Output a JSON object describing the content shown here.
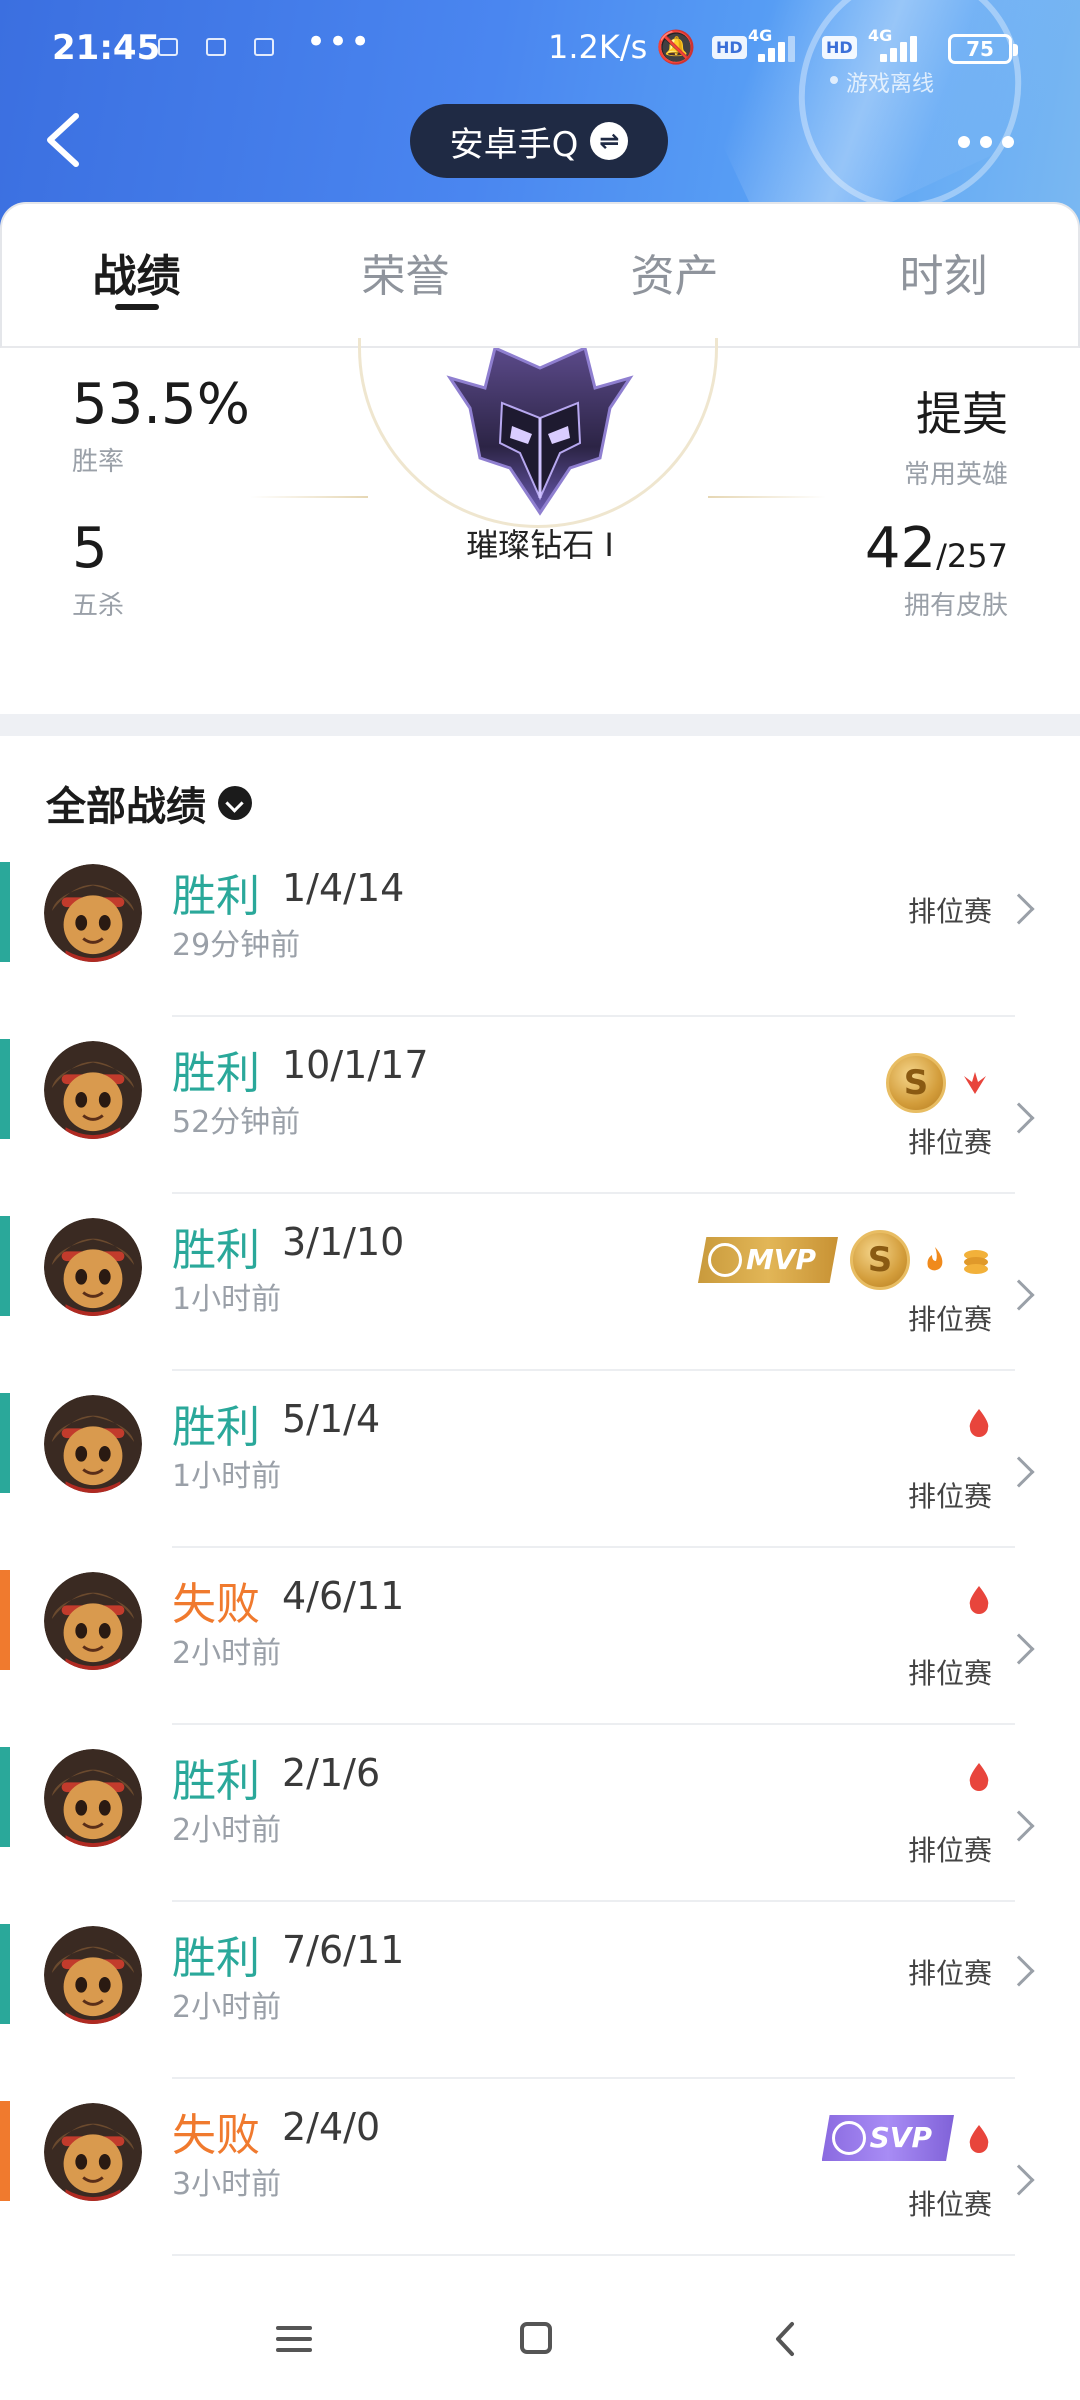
{
  "status_bar": {
    "time": "21:45",
    "more": "•••",
    "speed": "1.2K/s",
    "hd1": "HD",
    "net1": "4G",
    "hd2": "HD",
    "net2": "4G",
    "battery": "75",
    "game_status": "游戏离线"
  },
  "header": {
    "account_name": "安卓手Q",
    "switch_icon": "⇌"
  },
  "tabs": [
    {
      "label": "战绩"
    },
    {
      "label": "荣誉"
    },
    {
      "label": "资产"
    },
    {
      "label": "时刻"
    }
  ],
  "profile": {
    "win_rate": "53.5%",
    "win_rate_label": "胜率",
    "pentakills": "5",
    "pentakills_label": "五杀",
    "rank": "璀璨钻石 I",
    "favorite_hero": "提莫",
    "favorite_hero_label": "常用英雄",
    "skins_owned": "42",
    "skins_total": "/257",
    "skins_label": "拥有皮肤"
  },
  "match_list": {
    "title": "全部战绩",
    "colors": {
      "win": "#2aa89a",
      "loss": "#f07a2e"
    },
    "matches": [
      {
        "result": "胜利",
        "outcome": "win",
        "kda": "1/4/14",
        "time": "29分钟前",
        "type": "排位赛",
        "badges": []
      },
      {
        "result": "胜利",
        "outcome": "win",
        "kda": "10/1/17",
        "time": "52分钟前",
        "type": "排位赛",
        "badges": [
          "s-coin",
          "wings-icon"
        ]
      },
      {
        "result": "胜利",
        "outcome": "win",
        "kda": "3/1/10",
        "time": "1小时前",
        "type": "排位赛",
        "badges": [
          "mvp",
          "s-coin",
          "fire-icon",
          "coins-icon"
        ]
      },
      {
        "result": "胜利",
        "outcome": "win",
        "kda": "5/1/4",
        "time": "1小时前",
        "type": "排位赛",
        "badges": [
          "blood-icon"
        ]
      },
      {
        "result": "失败",
        "outcome": "loss",
        "kda": "4/6/11",
        "time": "2小时前",
        "type": "排位赛",
        "badges": [
          "blood-icon"
        ]
      },
      {
        "result": "胜利",
        "outcome": "win",
        "kda": "2/1/6",
        "time": "2小时前",
        "type": "排位赛",
        "badges": [
          "blood-icon"
        ]
      },
      {
        "result": "胜利",
        "outcome": "win",
        "kda": "7/6/11",
        "time": "2小时前",
        "type": "排位赛",
        "badges": []
      },
      {
        "result": "失败",
        "outcome": "loss",
        "kda": "2/4/0",
        "time": "3小时前",
        "type": "排位赛",
        "badges": [
          "svp",
          "blood-icon"
        ]
      }
    ],
    "badge_text": {
      "mvp": "MVP",
      "svp": "SVP",
      "coin": "S"
    }
  }
}
